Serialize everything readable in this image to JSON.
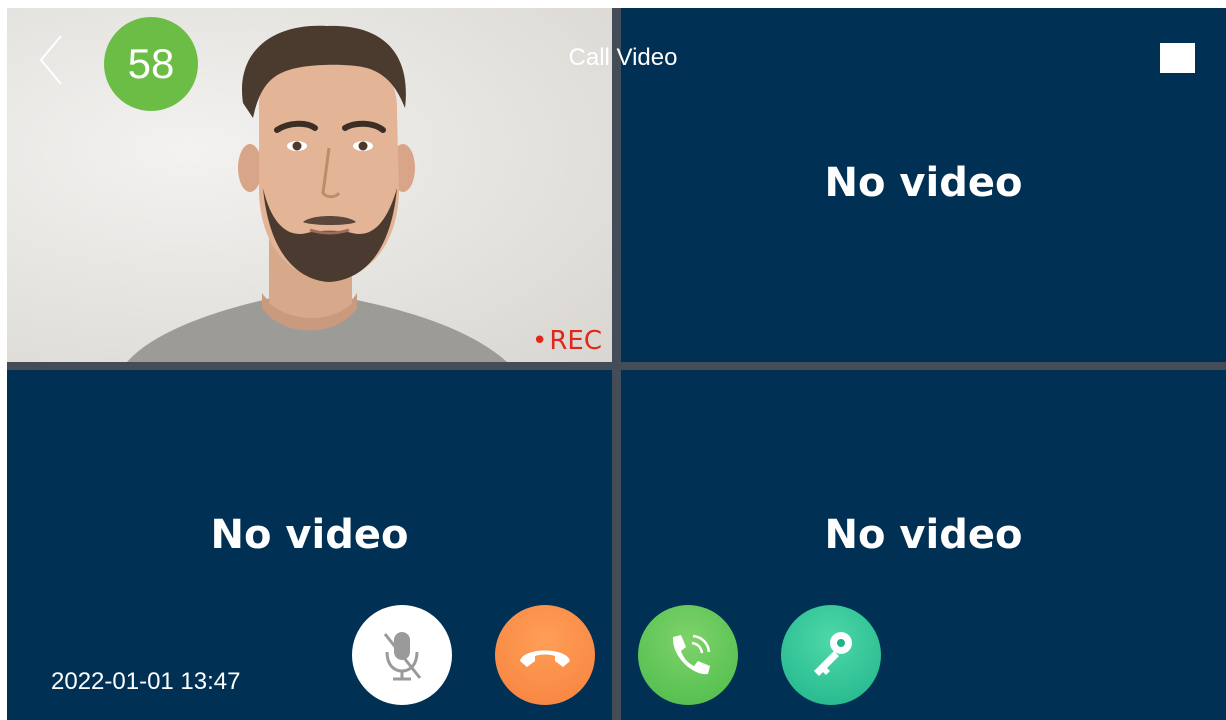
{
  "header": {
    "title": "Call Video",
    "countdown": "58",
    "back_icon": "chevron-left-icon",
    "fullscreen_icon": "fullscreen-square-icon",
    "countdown_color": "#6bbd45"
  },
  "panes": {
    "top_left": {
      "rec_label": "REC",
      "rec_dot": "•",
      "rec_color": "#e0271b"
    },
    "top_right": {
      "label": "No video"
    },
    "bottom_left": {
      "label": "No video"
    },
    "bottom_right": {
      "label": "No video"
    }
  },
  "footer": {
    "datetime": "2022-01-01 13:47"
  },
  "controls": [
    {
      "name": "mute-microphone",
      "icon": "microphone-muted-icon",
      "color": "#ffffff"
    },
    {
      "name": "hang-up",
      "icon": "phone-hangup-icon",
      "color": "#f6823f"
    },
    {
      "name": "answer-call",
      "icon": "phone-call-icon",
      "color": "#4cbb4a"
    },
    {
      "name": "unlock-door",
      "icon": "key-icon",
      "color": "#1fb48a"
    }
  ],
  "colors": {
    "pane_background": "#003154",
    "divider": "#434c57"
  }
}
